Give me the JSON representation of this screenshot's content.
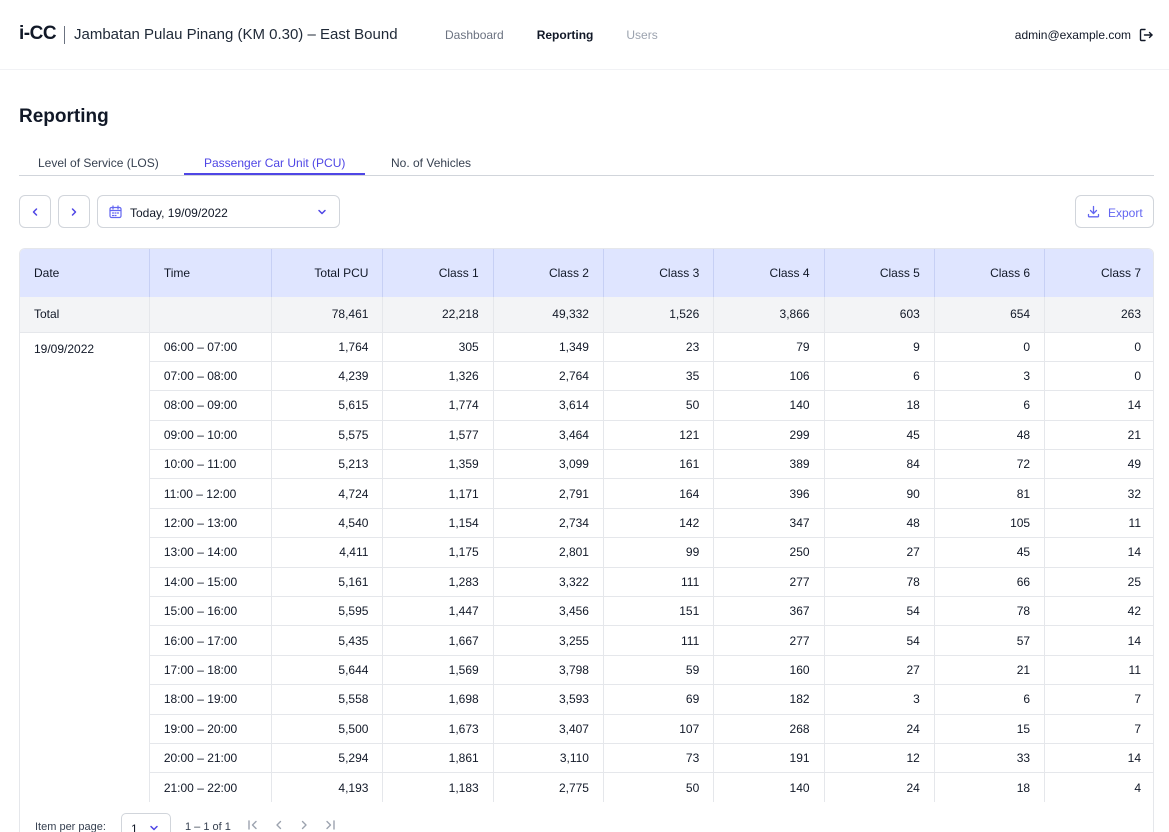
{
  "header": {
    "logo": "i-CC",
    "site_title": "Jambatan Pulau Pinang (KM 0.30) – East Bound",
    "nav": [
      "Dashboard",
      "Reporting",
      "Users"
    ],
    "user_email": "admin@example.com"
  },
  "page": {
    "title": "Reporting",
    "tabs": [
      "Level of Service (LOS)",
      "Passenger Car Unit (PCU)",
      "No. of Vehicles"
    ],
    "active_tab": "Passenger Car Unit (PCU)"
  },
  "toolbar": {
    "date_value": "Today, 19/09/2022",
    "export_label": "Export"
  },
  "table": {
    "columns": [
      "Date",
      "Time",
      "Total PCU",
      "Class 1",
      "Class 2",
      "Class 3",
      "Class 4",
      "Class 5",
      "Class 6",
      "Class 7"
    ],
    "total_row": [
      "Total",
      "",
      "78,461",
      "22,218",
      "49,332",
      "1,526",
      "3,866",
      "603",
      "654",
      "263"
    ],
    "date": "19/09/2022",
    "rows": [
      [
        "06:00 – 07:00",
        "1,764",
        "305",
        "1,349",
        "23",
        "79",
        "9",
        "0",
        "0"
      ],
      [
        "07:00 – 08:00",
        "4,239",
        "1,326",
        "2,764",
        "35",
        "106",
        "6",
        "3",
        "0"
      ],
      [
        "08:00 – 09:00",
        "5,615",
        "1,774",
        "3,614",
        "50",
        "140",
        "18",
        "6",
        "14"
      ],
      [
        "09:00 – 10:00",
        "5,575",
        "1,577",
        "3,464",
        "121",
        "299",
        "45",
        "48",
        "21"
      ],
      [
        "10:00 – 11:00",
        "5,213",
        "1,359",
        "3,099",
        "161",
        "389",
        "84",
        "72",
        "49"
      ],
      [
        "11:00 – 12:00",
        "4,724",
        "1,171",
        "2,791",
        "164",
        "396",
        "90",
        "81",
        "32"
      ],
      [
        "12:00 – 13:00",
        "4,540",
        "1,154",
        "2,734",
        "142",
        "347",
        "48",
        "105",
        "11"
      ],
      [
        "13:00 – 14:00",
        "4,411",
        "1,175",
        "2,801",
        "99",
        "250",
        "27",
        "45",
        "14"
      ],
      [
        "14:00 – 15:00",
        "5,161",
        "1,283",
        "3,322",
        "111",
        "277",
        "78",
        "66",
        "25"
      ],
      [
        "15:00 – 16:00",
        "5,595",
        "1,447",
        "3,456",
        "151",
        "367",
        "54",
        "78",
        "42"
      ],
      [
        "16:00 – 17:00",
        "5,435",
        "1,667",
        "3,255",
        "111",
        "277",
        "54",
        "57",
        "14"
      ],
      [
        "17:00 – 18:00",
        "5,644",
        "1,569",
        "3,798",
        "59",
        "160",
        "27",
        "21",
        "11"
      ],
      [
        "18:00 – 19:00",
        "5,558",
        "1,698",
        "3,593",
        "69",
        "182",
        "3",
        "6",
        "7"
      ],
      [
        "19:00 – 20:00",
        "5,500",
        "1,673",
        "3,407",
        "107",
        "268",
        "24",
        "15",
        "7"
      ],
      [
        "20:00 – 21:00",
        "5,294",
        "1,861",
        "3,110",
        "73",
        "191",
        "12",
        "33",
        "14"
      ],
      [
        "21:00 – 22:00",
        "4,193",
        "1,183",
        "2,775",
        "50",
        "140",
        "24",
        "18",
        "4"
      ]
    ]
  },
  "pagination": {
    "label": "Item per page:",
    "page_size": "1",
    "range": "1 – 1 of 1"
  },
  "colors": {
    "accent": "#4f46e5",
    "header_bg": "#dfe5ff",
    "total_row_bg": "#f3f4f6"
  }
}
